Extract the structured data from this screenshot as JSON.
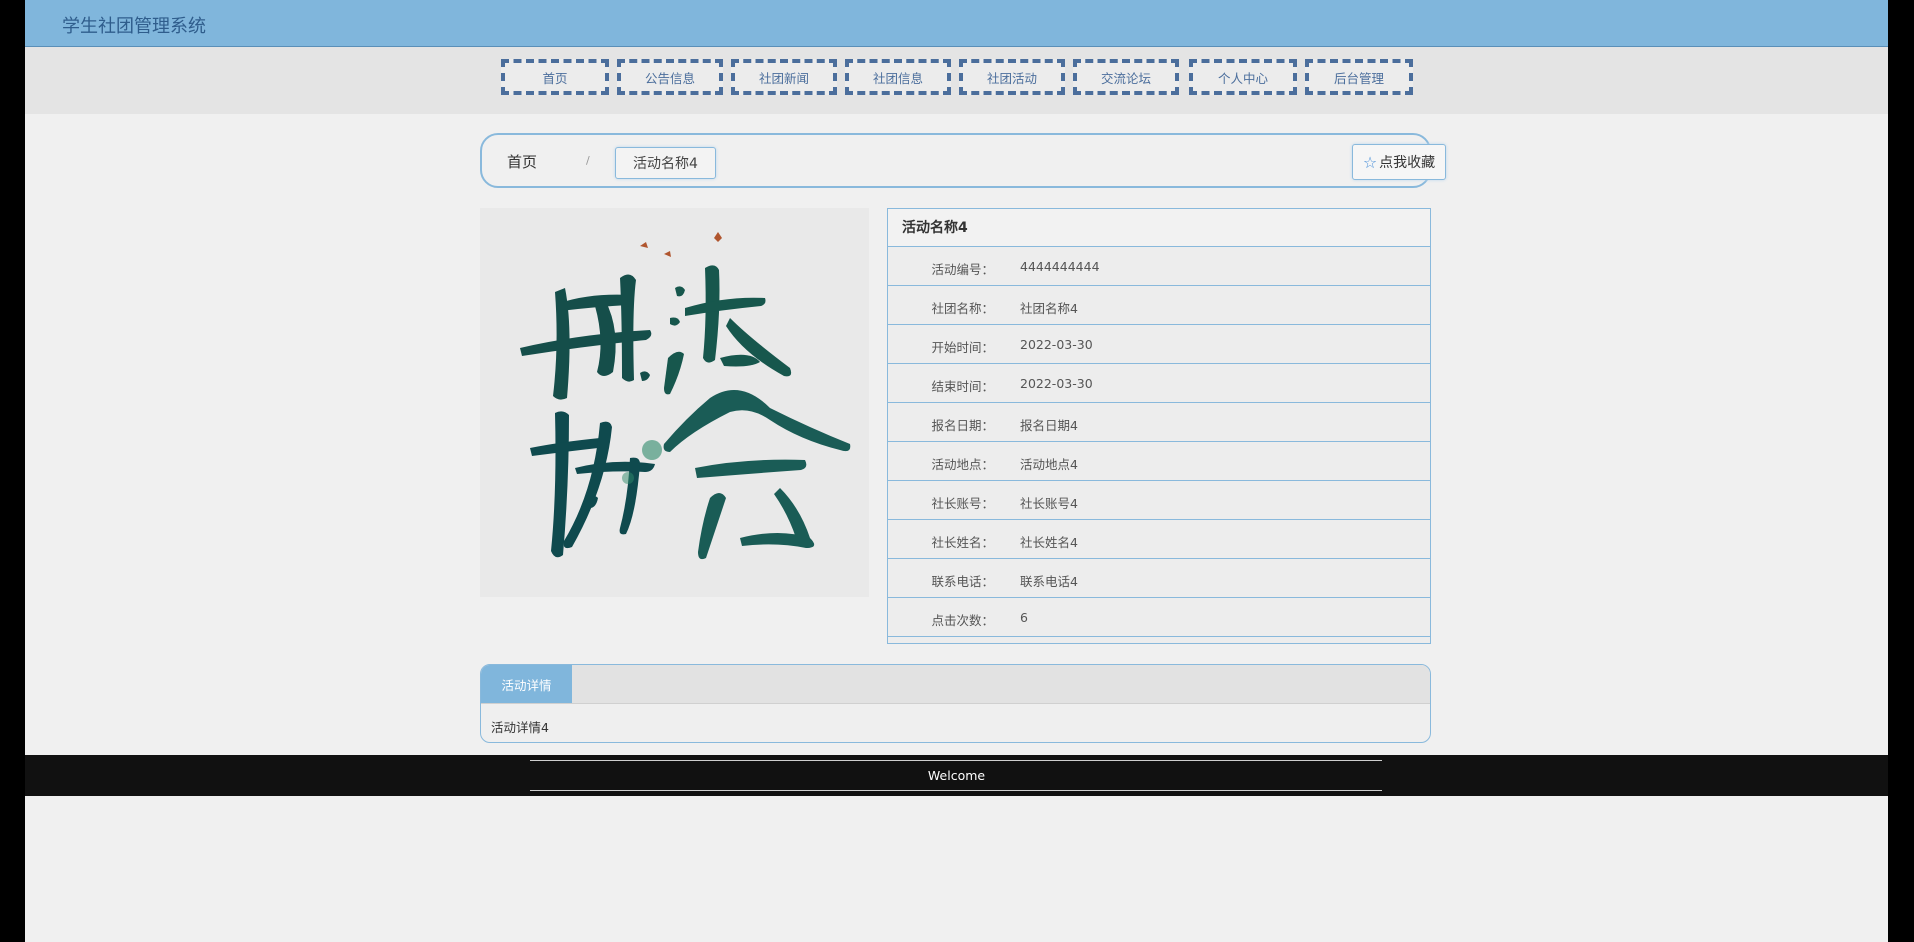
{
  "app": {
    "title": "学生社团管理系统"
  },
  "nav": {
    "items": [
      {
        "label": "首页"
      },
      {
        "label": "公告信息"
      },
      {
        "label": "社团新闻"
      },
      {
        "label": "社团信息"
      },
      {
        "label": "社团活动"
      },
      {
        "label": "交流论坛"
      },
      {
        "label": "个人中心"
      },
      {
        "label": "后台管理"
      }
    ]
  },
  "breadcrumb": {
    "home": "首页",
    "separator": "/",
    "current": "活动名称4"
  },
  "favorite": {
    "label": "点我收藏",
    "icon": "star-icon"
  },
  "poster": {
    "alt_text": "书法协会",
    "colors": [
      "#0f4d4a",
      "#1e6b5a",
      "#2f8a6a"
    ]
  },
  "details": {
    "title": "活动名称4",
    "fields": [
      {
        "label": "活动编号：",
        "value": "4444444444"
      },
      {
        "label": "社团名称：",
        "value": "社团名称4"
      },
      {
        "label": "开始时间：",
        "value": "2022-03-30"
      },
      {
        "label": "结束时间：",
        "value": "2022-03-30"
      },
      {
        "label": "报名日期：",
        "value": "报名日期4"
      },
      {
        "label": "活动地点：",
        "value": "活动地点4"
      },
      {
        "label": "社长账号：",
        "value": "社长账号4"
      },
      {
        "label": "社长姓名：",
        "value": "社长姓名4"
      },
      {
        "label": "联系电话：",
        "value": "联系电话4"
      },
      {
        "label": "点击次数：",
        "value": "6"
      }
    ]
  },
  "activity_detail": {
    "tab_label": "活动详情",
    "content": "活动详情4"
  },
  "footer": {
    "text": "Welcome"
  },
  "theme": {
    "accent": "#80b6dc",
    "nav_border": "#4b6e9c",
    "footer_bg": "#111111"
  }
}
